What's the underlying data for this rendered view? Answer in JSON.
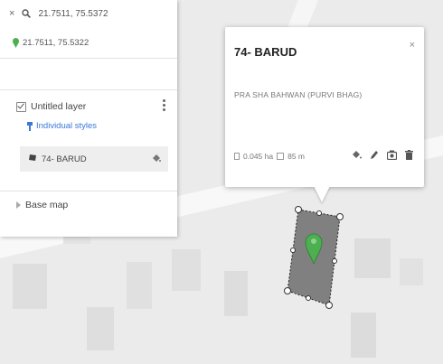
{
  "search": {
    "close_glyph": "×",
    "query": "21.7511, 75.5372"
  },
  "result": {
    "coords": "21.7511, 75.5322"
  },
  "layer": {
    "name": "Untitled layer",
    "styles_link": "Individual styles",
    "feature_name": "74- BARUD"
  },
  "base_map": {
    "label": "Base map"
  },
  "popup": {
    "title": "74- BARUD",
    "close_glyph": "×",
    "description": "PRA SHA BAHWAN (PURVI BHAG)",
    "area": "0.045 ha",
    "perimeter": "85 m"
  },
  "colors": {
    "pin_green": "#4caf50",
    "link_blue": "#3b78d8",
    "polygon_fill": "#808080",
    "map_bg": "#ebebeb"
  },
  "icons": [
    "close-icon",
    "search-icon",
    "map-pin-icon",
    "checkbox-icon",
    "more-vert-icon",
    "paint-icon",
    "polygon-icon",
    "paint-bucket-icon",
    "expand-arrow-icon",
    "area-icon",
    "ruler-icon",
    "edit-icon",
    "camera-icon",
    "delete-icon"
  ]
}
